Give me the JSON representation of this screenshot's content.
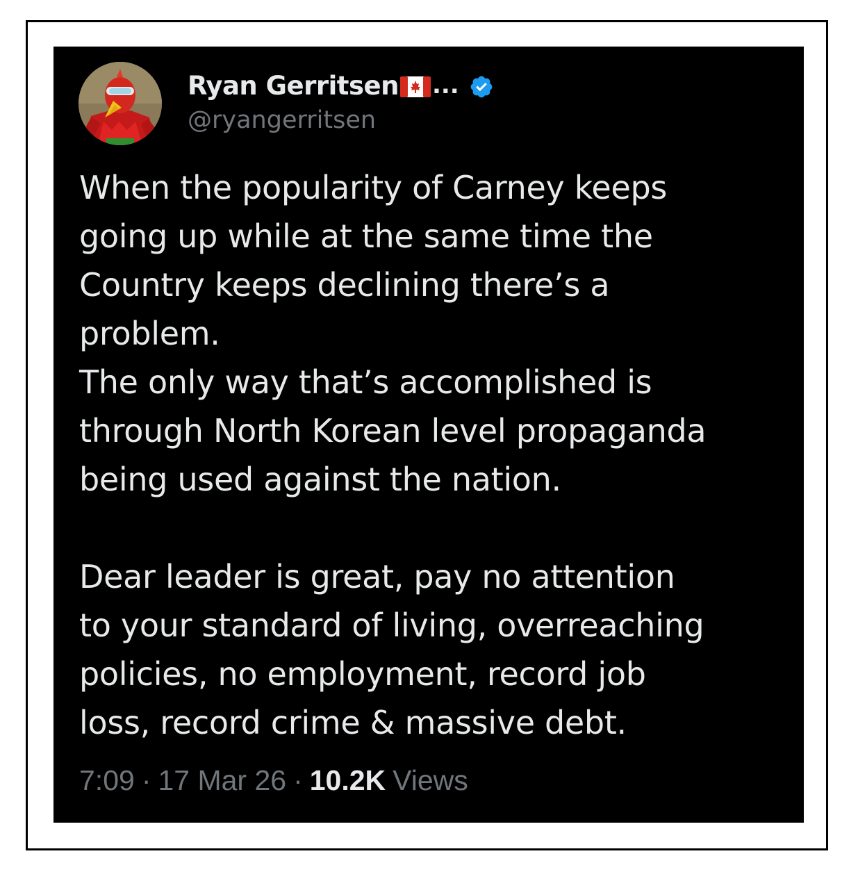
{
  "post": {
    "author": {
      "display_name": "Ryan Gerritsen",
      "flag_icon": "canada-flag-icon",
      "ellipsis": "...",
      "verified_icon": "verified-badge-icon",
      "handle": "@ryangerritsen"
    },
    "body": {
      "line_1": "When the popularity of Carney keeps",
      "line_2": "going up while at the same time the",
      "line_3": "Country keeps declining there’s a",
      "line_4": "problem.",
      "line_5": "The only way that’s accomplished is",
      "line_6": "through North Korean level propaganda",
      "line_7": "being used against the nation.",
      "line_8": "Dear leader is great, pay no attention",
      "line_9": "to your standard of living, overreaching",
      "line_10": "policies, no employment, record job",
      "line_11": "loss, record crime & massive debt."
    },
    "meta": {
      "time": "7:09",
      "separator": "·",
      "date": "17 Mar 26",
      "views_count": "10.2K",
      "views_label": "Views"
    },
    "colors": {
      "background": "#000000",
      "text": "#e7e9ea",
      "secondary_text": "#71767b",
      "verified": "#1d9bf0",
      "frame": "#000000"
    }
  }
}
